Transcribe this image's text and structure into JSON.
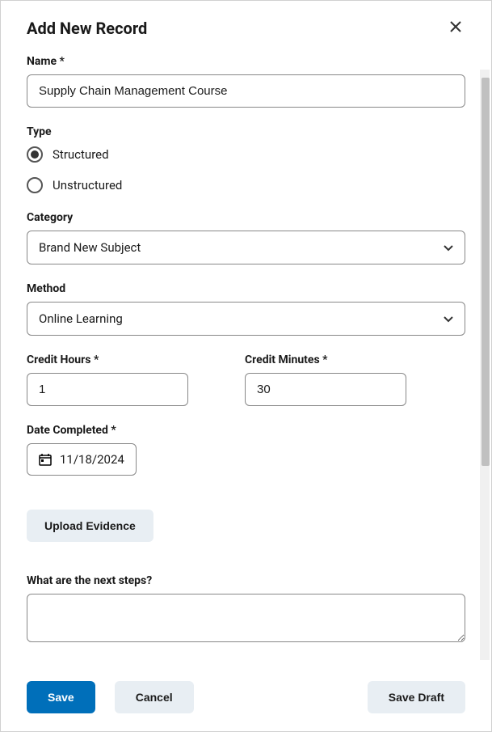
{
  "header": {
    "title": "Add New Record"
  },
  "form": {
    "name": {
      "label": "Name *",
      "value": "Supply Chain Management Course"
    },
    "type": {
      "label": "Type",
      "options": [
        {
          "label": "Structured",
          "selected": true
        },
        {
          "label": "Unstructured",
          "selected": false
        }
      ]
    },
    "category": {
      "label": "Category",
      "value": "Brand New Subject"
    },
    "method": {
      "label": "Method",
      "value": "Online Learning"
    },
    "credit_hours": {
      "label": "Credit Hours *",
      "value": "1"
    },
    "credit_minutes": {
      "label": "Credit Minutes *",
      "value": "30"
    },
    "date_completed": {
      "label": "Date Completed *",
      "value": "11/18/2024"
    },
    "upload_label": "Upload Evidence",
    "next_steps": {
      "label": "What are the next steps?",
      "value": ""
    }
  },
  "footer": {
    "save_label": "Save",
    "cancel_label": "Cancel",
    "draft_label": "Save Draft"
  }
}
